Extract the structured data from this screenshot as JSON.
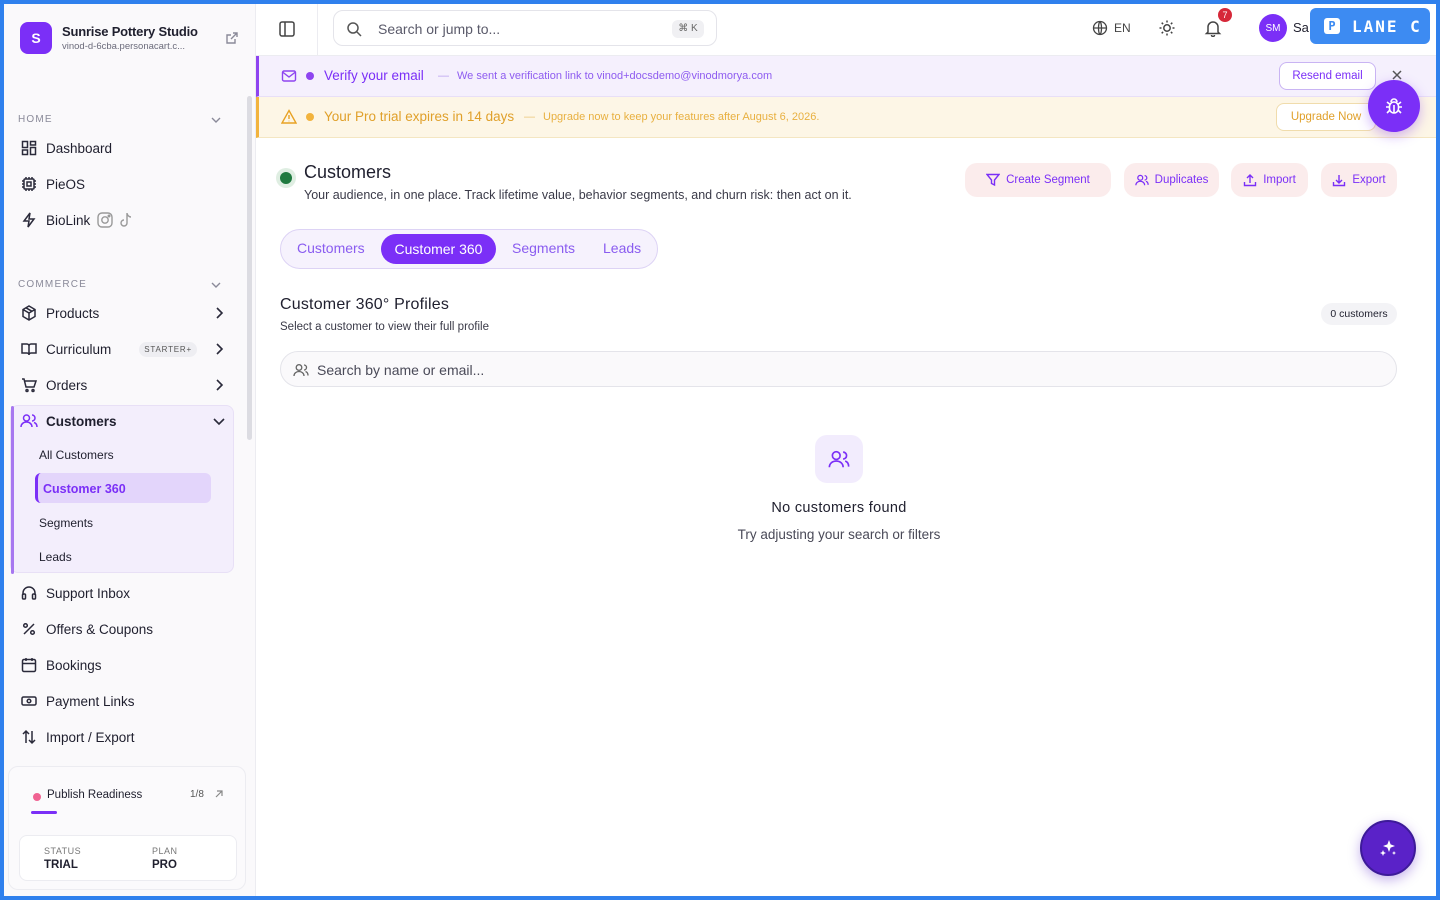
{
  "brand": {
    "initial": "S",
    "name": "Sunrise Pottery Studio",
    "url": "vinod-d-6cba.personacart.c..."
  },
  "sidebar": {
    "home_label": "HOME",
    "home_items": [
      {
        "label": "Dashboard",
        "icon": "dashboard-icon"
      },
      {
        "label": "PieOS",
        "icon": "chip-icon"
      },
      {
        "label": "BioLink",
        "icon": "bolt-icon"
      }
    ],
    "commerce_label": "COMMERCE",
    "commerce_items": [
      {
        "label": "Products",
        "icon": "box-icon"
      },
      {
        "label": "Curriculum",
        "icon": "book-icon",
        "badge": "STARTER+"
      },
      {
        "label": "Orders",
        "icon": "cart-icon"
      },
      {
        "label": "Customers",
        "icon": "users-icon"
      }
    ],
    "customers_sub": [
      "All Customers",
      "Customer 360",
      "Segments",
      "Leads"
    ],
    "more_items": [
      {
        "label": "Support Inbox",
        "icon": "headset-icon"
      },
      {
        "label": "Offers & Coupons",
        "icon": "percent-icon"
      },
      {
        "label": "Bookings",
        "icon": "calendar-icon"
      },
      {
        "label": "Payment Links",
        "icon": "cash-icon"
      },
      {
        "label": "Import / Export",
        "icon": "sort-arrows-icon"
      }
    ],
    "readiness": {
      "title": "Publish Readiness",
      "count": "1/8",
      "progress": 0.125,
      "status_label": "STATUS",
      "status_value": "TRIAL",
      "plan_label": "PLAN",
      "plan_value": "PRO"
    }
  },
  "topbar": {
    "search_placeholder": "Search or jump to...",
    "shortcut": "⌘ K",
    "language": "EN",
    "notifications": "7",
    "avatar_initials": "SM",
    "user_name": "Sa",
    "lane_badge": "LANE C",
    "lane_letter": "P"
  },
  "banners": {
    "verify": {
      "title": "Verify your email",
      "separator": "—",
      "message": "We sent a verification link to vinod+docsdemo@vinodmorya.com",
      "button": "Resend email"
    },
    "trial": {
      "title": "Your Pro trial expires in 14 days",
      "separator": "—",
      "message": "Upgrade now to keep your features after August 6, 2026.",
      "button": "Upgrade Now"
    }
  },
  "main": {
    "title": "Customers",
    "subtitle": "Your audience, in one place. Track lifetime value, behavior segments, and churn risk: then act on it.",
    "actions": [
      "Create Segment",
      "Duplicates",
      "Import",
      "Export"
    ],
    "tabs": [
      "Customers",
      "Customer 360",
      "Segments",
      "Leads"
    ],
    "section_title": "Customer 360° Profiles",
    "section_subtitle": "Select a customer to view their full profile",
    "count": "0 customers",
    "search_placeholder": "Search by name or email...",
    "empty_title": "No customers found",
    "empty_subtitle": "Try adjusting your search or filters"
  },
  "colors": {
    "accent": "#7b2ff7",
    "trial": "#f2b33d",
    "status": "#1f7a3f",
    "frame": "#2f80ed"
  }
}
